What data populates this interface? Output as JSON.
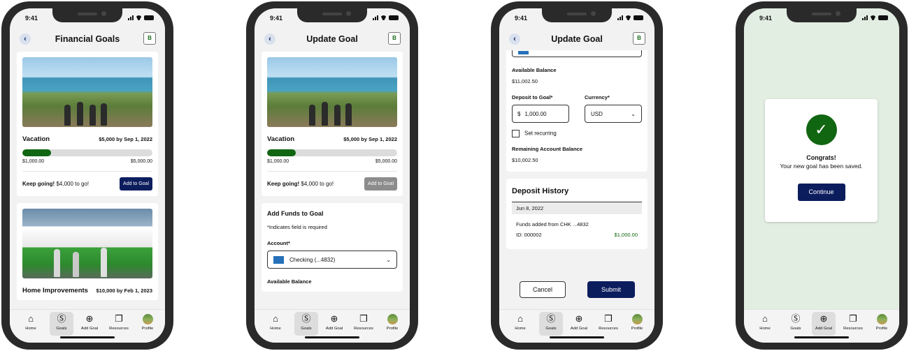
{
  "status": {
    "time": "9:41"
  },
  "tabbar": [
    {
      "label": "Home",
      "icon": "home-icon"
    },
    {
      "label": "Goals",
      "icon": "dollar-icon"
    },
    {
      "label": "Add Goal",
      "icon": "plus-circle-icon"
    },
    {
      "label": "Resources",
      "icon": "documents-icon"
    },
    {
      "label": "Profile",
      "icon": "avatar"
    }
  ],
  "screen1": {
    "title": "Financial Goals",
    "goals": [
      {
        "name": "Vacation",
        "target": "$5,000 by Sep 1, 2022",
        "progress": 0.2,
        "min": "$1,000.00",
        "max": "$5,000.00",
        "keep_bold": "Keep going!",
        "keep_rest": " $4,000 to go!",
        "button": "Add to Goal"
      },
      {
        "name": "Home Improvements",
        "target": "$10,000 by Feb 1, 2023"
      }
    ]
  },
  "screen2": {
    "title": "Update Goal",
    "goal": {
      "name": "Vacation",
      "target": "$5,000 by Sep 1, 2022",
      "progress": 0.2,
      "min": "$1,000.00",
      "max": "$5,000.00",
      "keep_bold": "Keep going!",
      "keep_rest": " $4,000 to go!",
      "button": "Add to Goal"
    },
    "form": {
      "heading": "Add Funds to Goal",
      "required_note": "*Indicates field is required",
      "account_label": "Account*",
      "account_value": "Checking (...4832)",
      "available_label": "Available Balance"
    }
  },
  "screen3": {
    "title": "Update Goal",
    "available_label": "Available Balance",
    "available_value": "$11,002.50",
    "deposit_label": "Deposit to Goal*",
    "deposit_currency_symbol": "$",
    "deposit_value": "1,000.00",
    "currency_label": "Currency*",
    "currency_value": "USD",
    "recurring_label": "Set recurring",
    "remaining_label": "Remaining Account Balance",
    "remaining_value": "$10,002.50",
    "history": {
      "heading": "Deposit History",
      "date": "Jun 8, 2022",
      "desc": "Funds added from CHK ...4832",
      "id": "ID: 000002",
      "amount": "$1,000.00"
    },
    "cancel": "Cancel",
    "submit": "Submit"
  },
  "screen4": {
    "congrats": "Congrats!",
    "message": "Your new goal has been saved.",
    "button": "Continue"
  },
  "colors": {
    "accent": "#0c1d5e",
    "progress": "#116611",
    "success_bg": "#e3eee3"
  }
}
